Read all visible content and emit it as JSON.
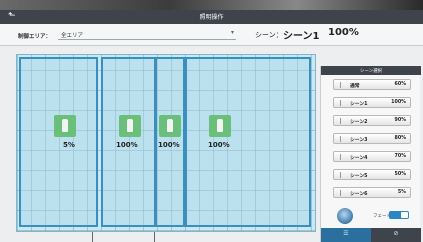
{
  "window": {
    "title": "照明操作",
    "back_icon": "back-arrow-icon"
  },
  "control": {
    "area_label": "制御エリア：",
    "area_value": "全エリア",
    "scene_label": "シーン：",
    "scene_name": "シーン1",
    "scene_percent": "100%"
  },
  "floor": {
    "zones": [
      {
        "value": "5%"
      },
      {
        "value": "100%"
      },
      {
        "value": "100%"
      },
      {
        "value": "100%"
      }
    ]
  },
  "panel": {
    "header": "シーン選択",
    "scenes": [
      {
        "name": "通常",
        "percent": "60%"
      },
      {
        "name": "シーン1",
        "percent": "100%"
      },
      {
        "name": "シーン2",
        "percent": "90%"
      },
      {
        "name": "シーン3",
        "percent": "80%"
      },
      {
        "name": "シーン4",
        "percent": "70%"
      },
      {
        "name": "シーン5",
        "percent": "50%"
      },
      {
        "name": "シーン6",
        "percent": "5%"
      }
    ],
    "fade_label": "フェード",
    "fade_on": true
  },
  "colors": {
    "titlebar": "#3f434c",
    "zone_border": "#3a8fbf",
    "lamp_on": "#6ac07a",
    "toggle": "#2b86c8"
  }
}
